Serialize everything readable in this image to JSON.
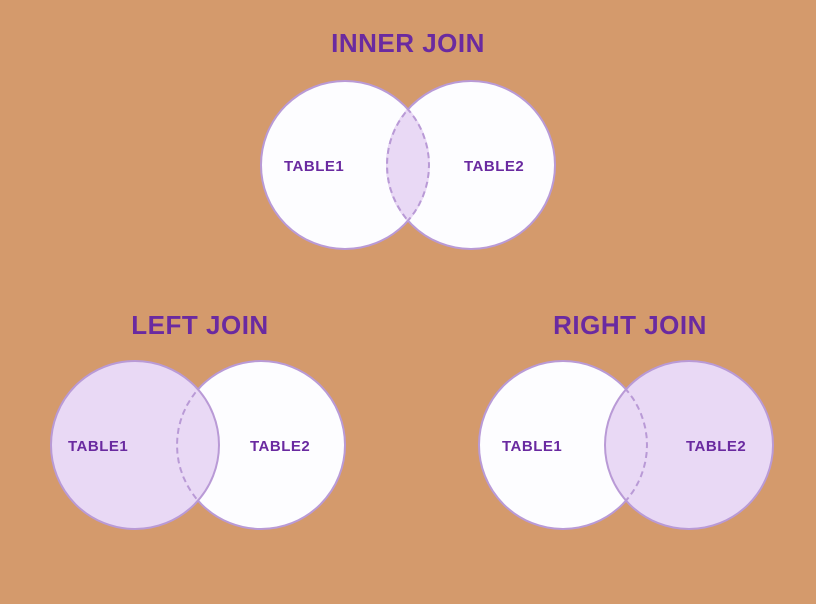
{
  "diagrams": {
    "inner": {
      "title": "INNER JOIN",
      "left_label": "TABLE1",
      "right_label": "TABLE2"
    },
    "left": {
      "title": "LEFT JOIN",
      "left_label": "TABLE1",
      "right_label": "TABLE2"
    },
    "right": {
      "title": "RIGHT JOIN",
      "left_label": "TABLE1",
      "right_label": "TABLE2"
    }
  }
}
